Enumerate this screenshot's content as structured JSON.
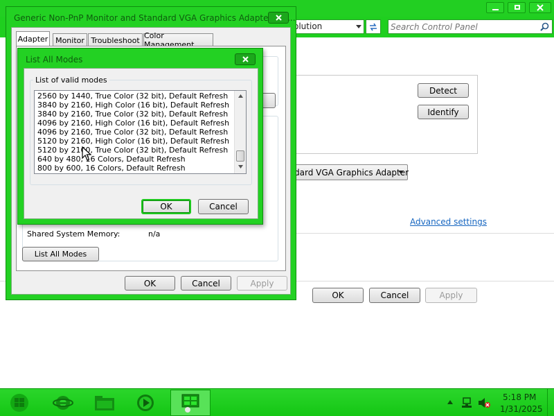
{
  "background_window": {
    "address_text": "olution",
    "search_placeholder": "Search Control Panel",
    "detect_label": "Detect",
    "identify_label": "Identify",
    "display_select_text": "dard VGA Graphics Adapter",
    "advanced_settings_link": "Advanced settings",
    "ok_label": "OK",
    "cancel_label": "Cancel",
    "apply_label": "Apply"
  },
  "properties_dialog": {
    "title": "Generic Non-PnP Monitor and Standard VGA Graphics Adapter Pro...",
    "tabs": [
      "Adapter",
      "Monitor",
      "Troubleshoot",
      "Color Management"
    ],
    "active_tab": "Adapter",
    "shared_memory_label": "Shared System Memory:",
    "shared_memory_value": "n/a",
    "list_all_modes_label": "List All Modes",
    "ok_label": "OK",
    "cancel_label": "Cancel",
    "apply_label": "Apply"
  },
  "list_modes_dialog": {
    "title": "List All Modes",
    "group_label": "List of valid modes",
    "modes": [
      "2560 by 1440, True Color (32 bit), Default Refresh",
      "3840 by 2160, High Color (16 bit), Default Refresh",
      "3840 by 2160, True Color (32 bit), Default Refresh",
      "4096 by 2160, High Color (16 bit), Default Refresh",
      "4096 by 2160, True Color (32 bit), Default Refresh",
      "5120 by 2160, High Color (16 bit), Default Refresh",
      "5120 by 2160, True Color (32 bit), Default Refresh",
      "640 by 480, 16 Colors, Default Refresh",
      "800 by 600, 16 Colors, Default Refresh"
    ],
    "ok_label": "OK",
    "cancel_label": "Cancel"
  },
  "taskbar": {
    "time": "5:18 PM",
    "date": "1/31/2025"
  },
  "icons": {
    "start": "windows-logo-icon",
    "ie": "internet-explorer-icon",
    "explorer": "folder-icon",
    "media": "media-player-icon",
    "control_panel": "control-panel-icon",
    "tray_arrow": "show-hidden-icons-icon",
    "network": "network-icon",
    "volume": "volume-muted-icon"
  },
  "colors": {
    "window_frame": "#23d123",
    "taskbar": "#1ed41e",
    "close_button": "#1ca81c",
    "link": "#1565c0"
  }
}
